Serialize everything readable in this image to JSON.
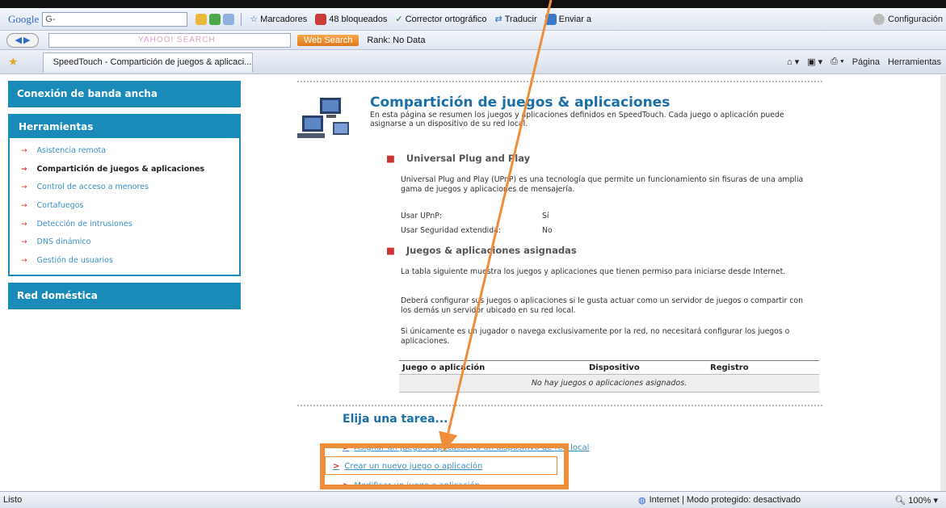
{
  "toolbar1": {
    "google_label": "Google",
    "google_box": "G-",
    "favorites": "Marcadores",
    "blocked": "48 bloqueados",
    "spell": "Corrector ortográfico",
    "translate": "Traducir",
    "send": "Enviar a",
    "settings": "Configuración"
  },
  "toolbar2": {
    "yahoo_search_placeholder": "YAHOO! SEARCH",
    "web_search": "Web Search",
    "rank": "Rank: No Data"
  },
  "tabbar": {
    "tab_title": "SpeedTouch - Compartición de juegos & aplicaci...",
    "page_menu": "Página",
    "tools_menu": "Herramientas"
  },
  "sidebar": {
    "broadband": "Conexión de banda ancha",
    "tools_heading": "Herramientas",
    "items": [
      "Asistencia remota",
      "Compartición de juegos & aplicaciones",
      "Control de acceso a menores",
      "Cortafuegos",
      "Detección de intrusiones",
      "DNS dinámico",
      "Gestión de usuarios"
    ],
    "home_network": "Red doméstica"
  },
  "main": {
    "title": "Compartición de juegos & aplicaciones",
    "description": "En esta página se resumen los juegos y aplicaciones definidos en SpeedTouch. Cada juego o aplicación puede asignarse a un dispositivo de su red local.",
    "upnp_heading": "Universal Plug and Play",
    "upnp_text": "Universal Plug and Play (UPnP) es una tecnología que permite un funcionamiento sin fisuras de una amplia gama de juegos y aplicaciones de mensajería.",
    "use_upnp_label": "Usar UPnP:",
    "use_upnp_value": "Sí",
    "ext_security_label": "Usar Seguridad extendida:",
    "ext_security_value": "No",
    "assigned_heading": "Juegos & aplicaciones asignadas",
    "assigned_p1": "La tabla siguiente muestra los juegos y aplicaciones que tienen permiso para iniciarse desde Internet.",
    "assigned_p2": "Deberá configurar sus juegos o aplicaciones si le gusta actuar como un servidor de juegos o compartir con los demás un servidor ubicado en su red local.",
    "assigned_p3": "Si únicamente es un jugador o navega exclusivamente por la red, no necesitará configurar los juegos o aplicaciones.",
    "table": {
      "headers": [
        "Juego o aplicación",
        "Dispositivo",
        "Registro"
      ],
      "empty": "No hay juegos o aplicaciones asignados."
    },
    "tasks_heading": "Elija una tarea...",
    "task1": "Asignar un juego o aplicación a un dispositivo de red local",
    "task2": "Crear un nuevo juego o aplicación",
    "task3": "Modificar un juego o aplicación"
  },
  "statusbar": {
    "text": "Listo",
    "zone": "Internet | Modo protegido: desactivado",
    "zoom": "100%"
  },
  "colors": {
    "sidebar_blue": "#1a8ab8",
    "title_blue": "#1b6fa8",
    "annotation_orange": "#ef8e3a",
    "bullet_red": "#d52c2c"
  }
}
